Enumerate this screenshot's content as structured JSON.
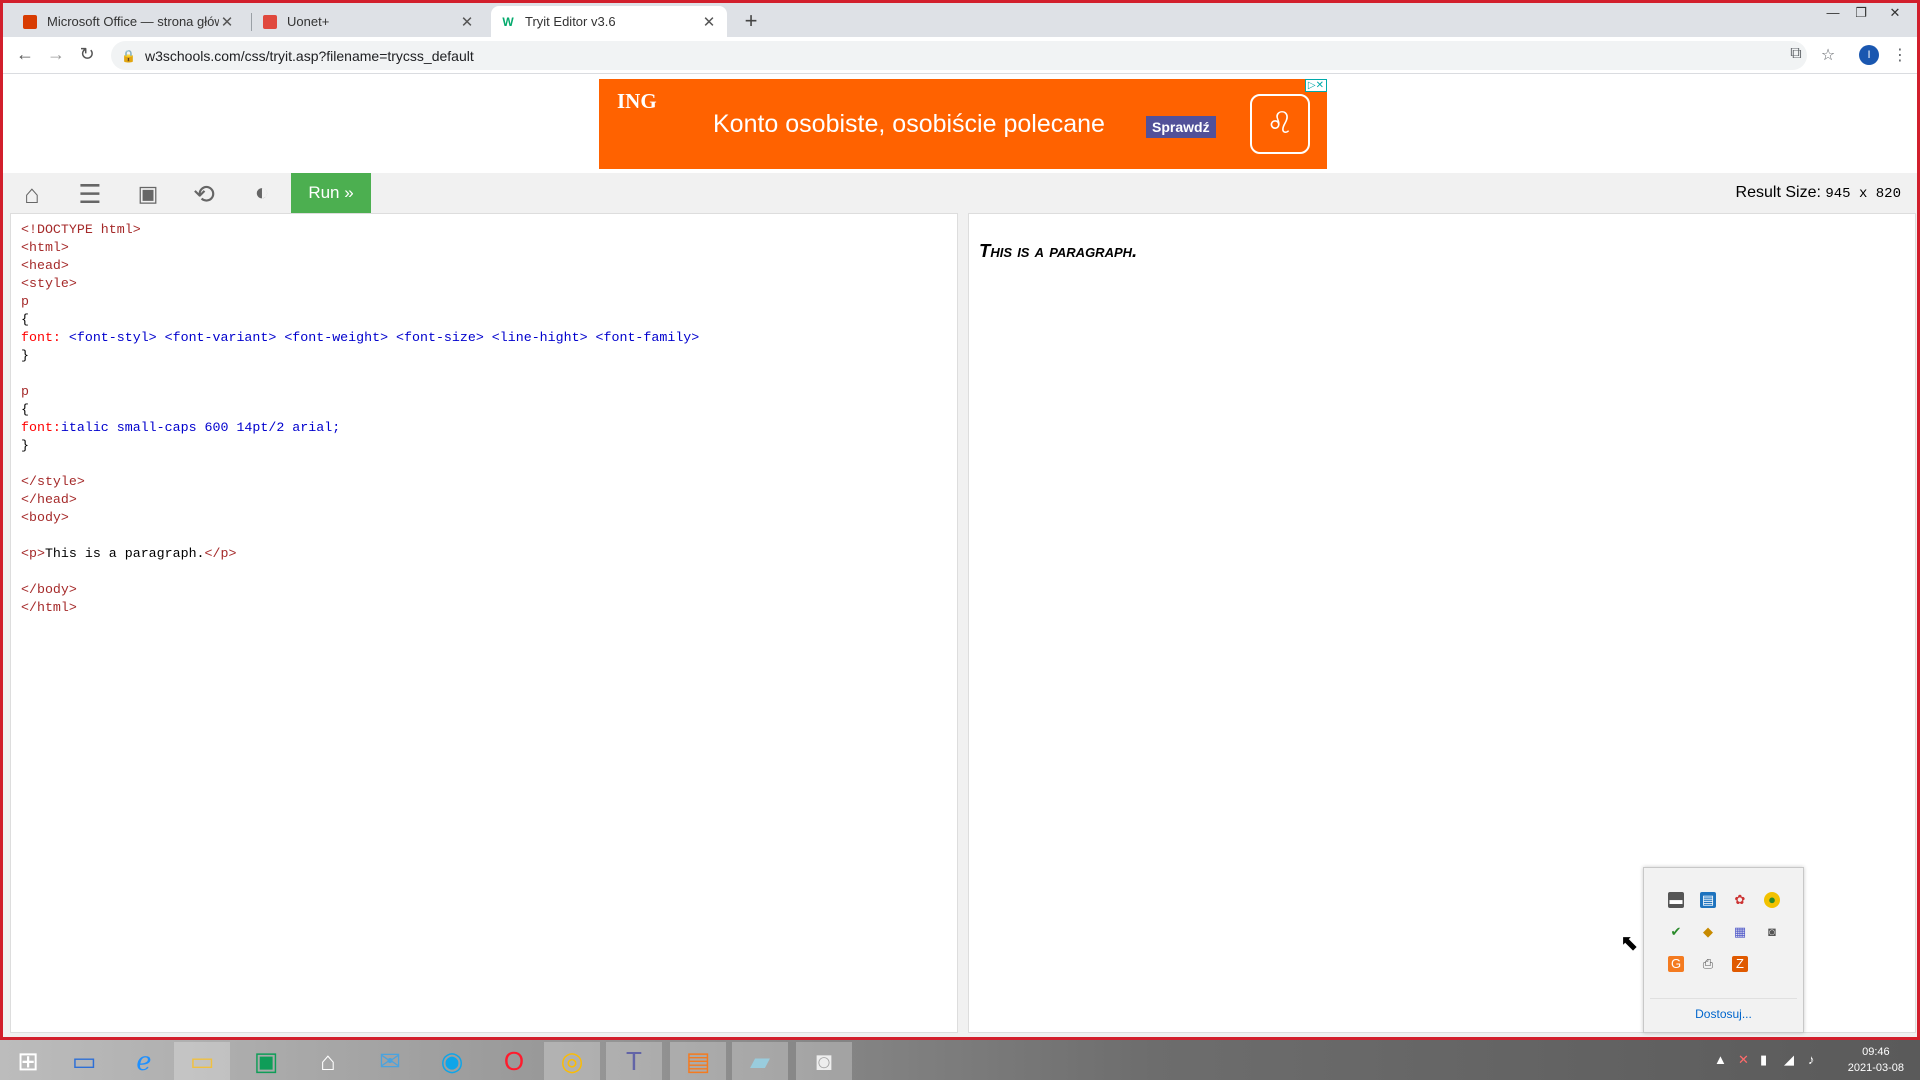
{
  "browser": {
    "tabs": [
      {
        "title": "Microsoft Office — strona główna",
        "favicon": "office-icon",
        "active": false
      },
      {
        "title": "Uonet+",
        "favicon": "uonet-icon",
        "active": false
      },
      {
        "title": "Tryit Editor v3.6",
        "favicon": "w3schools-icon",
        "active": true
      }
    ],
    "url": "w3schools.com/css/tryit.asp?filename=trycss_default",
    "profile_initial": "I"
  },
  "ad": {
    "brand": "ING",
    "headline": "Konto osobiste, osobiście polecane",
    "cta": "Sprawdź"
  },
  "toolbar": {
    "icons": [
      "home-icon",
      "menu-icon",
      "save-icon",
      "rotate-icon",
      "theme-icon"
    ],
    "run_label": "Run »",
    "result_size_label": "Result Size:",
    "result_size_value": "945 x 820"
  },
  "editor": {
    "lines": [
      "<!DOCTYPE html>",
      "<html>",
      "<head>",
      "<style>",
      "p",
      "{",
      "font: <font-styl> <font-variant> <font-weight> <font-size> <line-hight> <font-family>",
      "}",
      "",
      "p",
      "{",
      "font:italic small-caps 600 14pt/2 arial;",
      "}",
      "",
      "</style>",
      "</head>",
      "<body>",
      "",
      "<p>This is a paragraph.</p>",
      "",
      "</body>",
      "</html>"
    ]
  },
  "result": {
    "paragraph": "This is a paragraph."
  },
  "tray_popup": {
    "link": "Dostosuj..."
  },
  "taskbar": {
    "apps": [
      "windows-start-icon",
      "lenovo-icon",
      "internet-explorer-icon",
      "file-explorer-icon",
      "store-icon",
      "home-icon",
      "mail-icon",
      "edge-icon",
      "opera-icon",
      "chrome-icon",
      "teams-icon",
      "pdf-icon",
      "notepad-icon",
      "camera-icon"
    ],
    "time": "09:46",
    "date": "2021-03-08"
  }
}
